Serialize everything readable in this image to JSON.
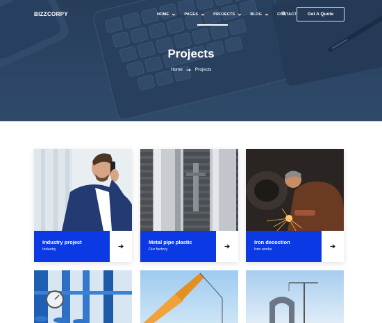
{
  "brand": {
    "logo": "BIZZCORPY"
  },
  "nav": {
    "items": [
      {
        "label": "HOME",
        "has_caret": true
      },
      {
        "label": "PAGES",
        "has_caret": true
      },
      {
        "label": "PROJECTS",
        "has_caret": true,
        "active": true
      },
      {
        "label": "BLOG",
        "has_caret": true
      },
      {
        "label": "CONTACT",
        "has_caret": false
      }
    ],
    "search_icon": "search-icon",
    "cta_label": "Get A Quote"
  },
  "hero": {
    "title": "Projects",
    "breadcrumb": {
      "home": "Home",
      "current": "Projects",
      "separator_icon": "arrow-right-icon"
    }
  },
  "projects": [
    {
      "title": "Industry project",
      "category": "Industry",
      "image": "businessman-on-phone"
    },
    {
      "title": "Metal pipe plastic",
      "category": "Our factory",
      "image": "metal-pipes"
    },
    {
      "title": "Iron decoction",
      "category": "Iron works",
      "image": "welder-sparks"
    }
  ],
  "projects_row2": [
    {
      "image": "industrial-gauges"
    },
    {
      "image": "orange-crane"
    },
    {
      "image": "construction-crane"
    }
  ],
  "colors": {
    "accent": "#0b39e3",
    "hero_overlay": "#34506f",
    "text_dark": "#1a1a2e"
  }
}
